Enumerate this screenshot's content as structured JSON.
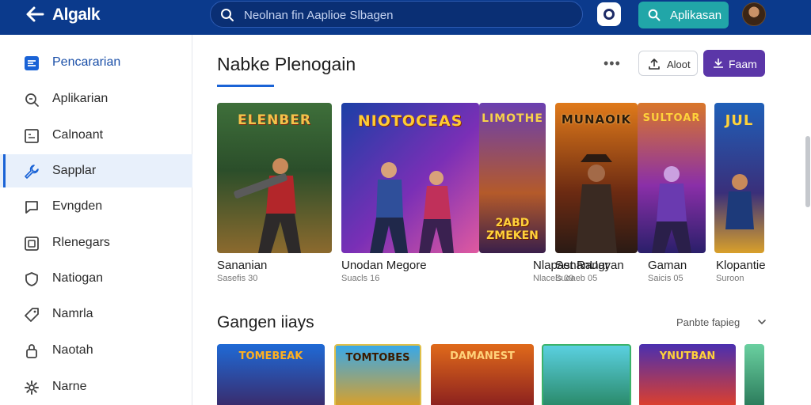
{
  "topbar": {
    "title": "Algalk",
    "search_text": "Neolnan fin Aaplioe Slbagen",
    "apps_button": "Aplikasan"
  },
  "sidebar": {
    "items": [
      {
        "label": "Pencararian",
        "icon": "dashboard-icon"
      },
      {
        "label": "Aplikarian",
        "icon": "search-icon"
      },
      {
        "label": "Calnoant",
        "icon": "calendar-icon"
      },
      {
        "label": "Sapplar",
        "icon": "wrench-icon"
      },
      {
        "label": "Evngden",
        "icon": "chat-icon"
      },
      {
        "label": "Rlenegars",
        "icon": "gallery-icon"
      },
      {
        "label": "Natiogan",
        "icon": "shield-icon"
      },
      {
        "label": "Namrla",
        "icon": "tag-icon"
      },
      {
        "label": "Naotah",
        "icon": "lock-icon"
      },
      {
        "label": "Narne",
        "icon": "gear-icon"
      }
    ],
    "selected_index": 3
  },
  "main": {
    "section1_title": "Nabke Plenogain",
    "more": "•••",
    "outline_button": "Aloot",
    "purple_button": "Faam",
    "cards": [
      {
        "art": "ELENBER",
        "label": "Sananian",
        "sub": "Sasefis 30"
      },
      {
        "art": "NIOTOCEAS",
        "label": "Unodan Megore",
        "sub": "Suacls 16"
      },
      {
        "art": "LIMOTHE",
        "label": "Nlapast Rangr",
        "sub": "Nlacels 09"
      },
      {
        "art": "MUNAOIK",
        "label": "SenanUayan",
        "sub": "Suoaeb 05"
      },
      {
        "art": "SULTOAR",
        "label": "Gaman",
        "sub": "Saicis 05"
      },
      {
        "art": "JUL",
        "label": "Klopantie",
        "sub": "Suroon"
      }
    ],
    "section2_title": "Gangen iiays",
    "sort_label": "Panbte fapieg",
    "tiles": [
      {
        "art": "TOMEBEAK"
      },
      {
        "art": "TOMTOBES"
      },
      {
        "art": "DAMANEST"
      },
      {
        "art": ""
      },
      {
        "art": "YNUTBAN"
      },
      {
        "art": ""
      }
    ],
    "banner_text": "2ABD ZMEKEN"
  },
  "colors": {
    "topbar": "#0b3a8c",
    "accent_blue": "#1a63d6",
    "teal": "#21a6a8",
    "purple": "#5b36a8"
  }
}
